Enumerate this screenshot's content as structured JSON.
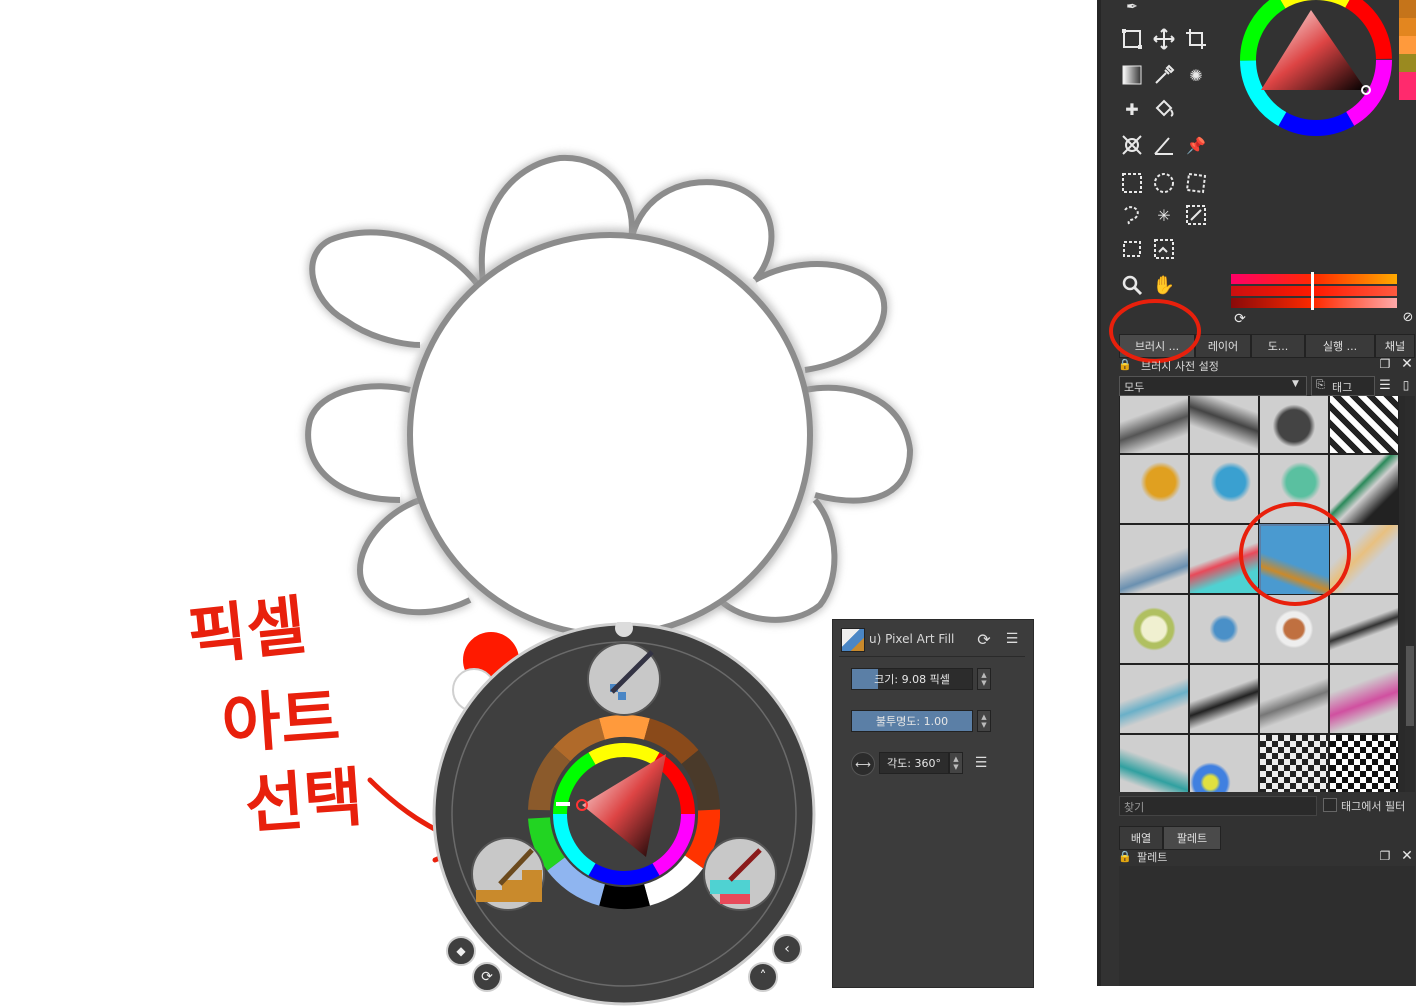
{
  "annotation": {
    "line1": "픽셀",
    "line2": "아트",
    "line3": "선택",
    "color": "#e8200c"
  },
  "panel": {
    "tabs": [
      "브러시 ...",
      "레이어",
      "도...",
      "실행 ...",
      "채널"
    ],
    "presets_title": "브러시 사전 설정",
    "filter_all": "모두",
    "tag_label": "태그",
    "search_placeholder": "찾기",
    "filter_by_tag": "태그에서 필터",
    "lower_tabs": [
      "배열",
      "팔레트"
    ],
    "palette_title": "팔레트"
  },
  "brush_settings": {
    "preset_name": "u) Pixel Art Fill",
    "size_label": "크기: 9.08 픽셀",
    "size_fraction": 0.22,
    "opacity_label": "불투명도: 1.00",
    "opacity_fraction": 1.0,
    "angle_label": "각도: 360°"
  },
  "colors": {
    "panel_bg": "#323232",
    "accent": "#5b7fa6",
    "fg_color": "#ff1a00"
  }
}
